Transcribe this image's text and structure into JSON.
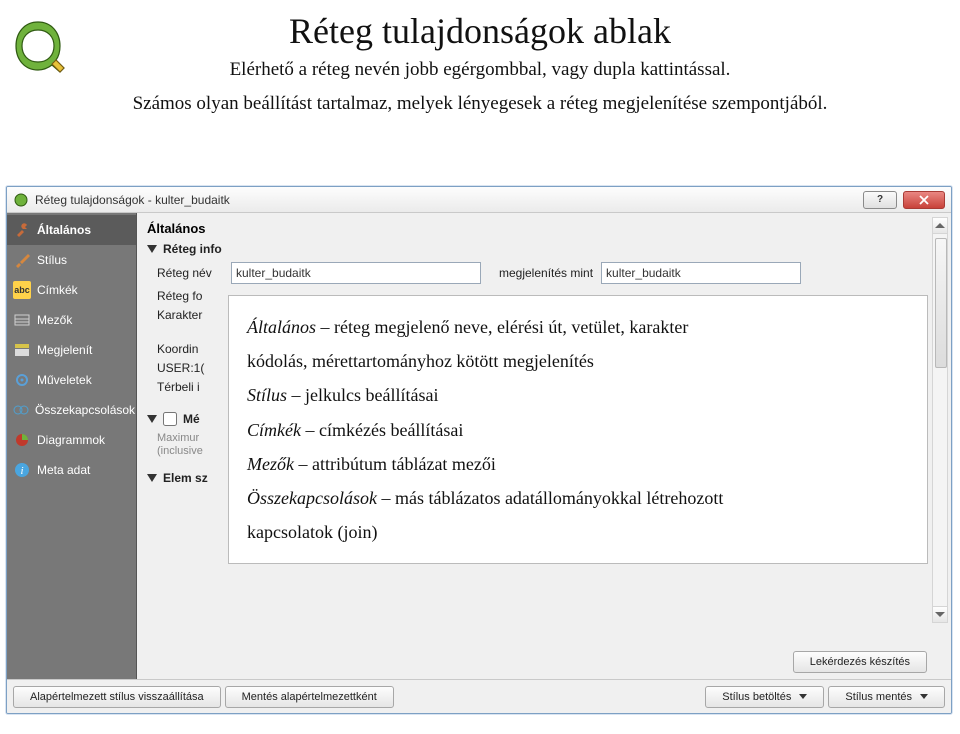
{
  "slide": {
    "title": "Réteg tulajdonságok ablak",
    "line1": "Elérhető a réteg nevén jobb egérgombbal, vagy dupla kattintással.",
    "line2": "Számos olyan beállítást tartalmaz, melyek lényegesek a réteg megjelenítése szempontjából."
  },
  "window": {
    "title": "Réteg tulajdonságok - kulter_budaitk"
  },
  "sidebar": {
    "items": [
      {
        "label": "Általános"
      },
      {
        "label": "Stílus"
      },
      {
        "label": "Címkék"
      },
      {
        "label": "Mezők"
      },
      {
        "label": "Megjelenít"
      },
      {
        "label": "Műveletek"
      },
      {
        "label": "Összekapcsolások"
      },
      {
        "label": "Diagrammok"
      },
      {
        "label": "Meta adat"
      }
    ]
  },
  "main": {
    "section_title": "Általános",
    "collapse1": "Réteg info",
    "row_layer_name": "Réteg név",
    "val_layer_name": "kulter_budaitk",
    "row_display_as": "megjelenítés mint",
    "val_display_as": "kulter_budaitk",
    "row_layer_fo": "Réteg fo",
    "row_karakter": "Karakter",
    "row_koordin": "Koordin",
    "row_user1": "USER:1(",
    "row_terbel": "Térbeli i",
    "collapse2": "Mé",
    "row_maximur": "Maximur",
    "row_inclusive": "(inclusive",
    "collapse3": "Elem sz"
  },
  "overlay": {
    "line1_em": "Általános",
    "line1_rest": " – réteg megjelenő neve, elérési út, vetület, karakter",
    "line2": "kódolás, mérettartományhoz kötött megjelenítés",
    "line3_em": "Stílus",
    "line3_rest": " – jelkulcs beállításai",
    "line4_em": "Címkék",
    "line4_rest": " – címkézés beállításai",
    "line5_em": "Mezők",
    "line5_rest": " – attribútum táblázat mezői",
    "line6_em": "Összekapcsolások",
    "line6_rest": " – más táblázatos adatállományokkal létrehozott",
    "line7": "kapcsolatok (join)"
  },
  "bottom": {
    "b1": "Alapértelmezett stílus visszaállítása",
    "b2": "Mentés alapértelmezettként",
    "b3": "Stílus betöltés",
    "b4": "Stílus mentés",
    "b5": "Lekérdezés készítés"
  }
}
